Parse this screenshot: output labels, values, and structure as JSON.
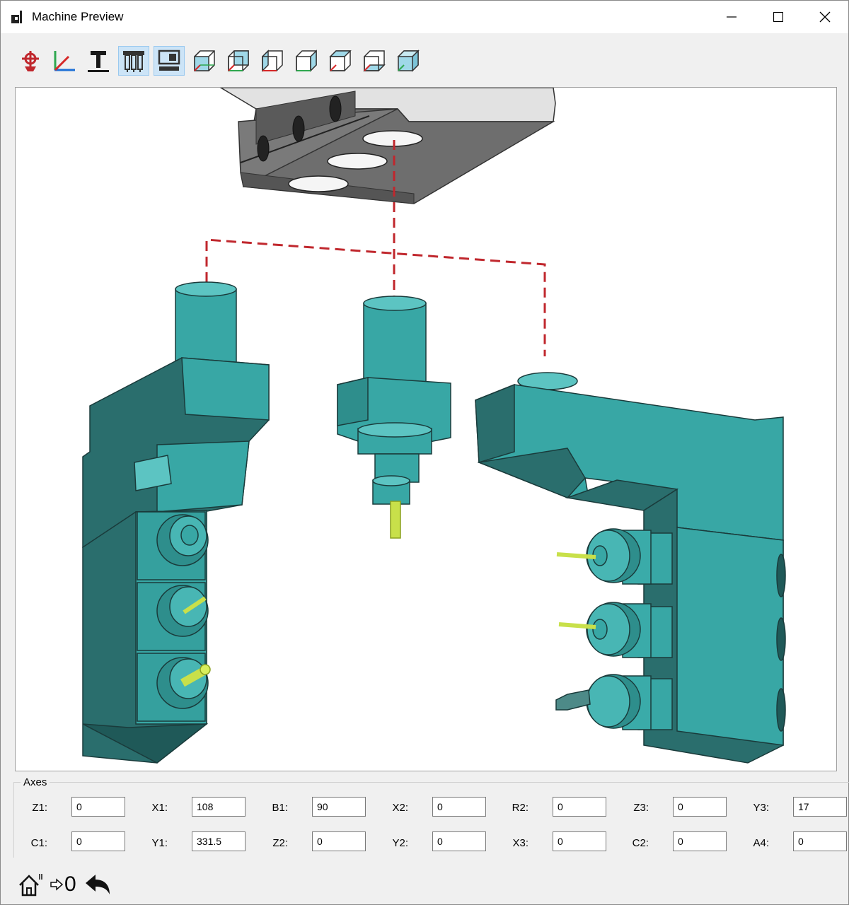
{
  "window": {
    "title": "Machine Preview"
  },
  "toolbar": {
    "buttons": [
      {
        "icon": "machine-icon",
        "active": false
      },
      {
        "icon": "axes-icon",
        "active": false
      },
      {
        "icon": "text-icon",
        "active": false
      },
      {
        "icon": "tools-icon",
        "active": true
      },
      {
        "icon": "workpiece-icon",
        "active": true
      },
      {
        "icon": "view-cube-front-icon",
        "active": false
      },
      {
        "icon": "view-cube-back-icon",
        "active": false
      },
      {
        "icon": "view-cube-left-icon",
        "active": false
      },
      {
        "icon": "view-cube-right-icon",
        "active": false
      },
      {
        "icon": "view-cube-top-icon",
        "active": false
      },
      {
        "icon": "view-cube-bottom-icon",
        "active": false
      },
      {
        "icon": "view-cube-iso-icon",
        "active": false
      }
    ]
  },
  "colors": {
    "accent_teal": "#38a7a5",
    "tool_yellow": "#c8e04a",
    "link_red": "#c0272d"
  },
  "axes": {
    "legend": "Axes",
    "row1": [
      {
        "label": "Z1:",
        "value": "0"
      },
      {
        "label": "X1:",
        "value": "108"
      },
      {
        "label": "B1:",
        "value": "90"
      },
      {
        "label": "X2:",
        "value": "0"
      },
      {
        "label": "R2:",
        "value": "0"
      },
      {
        "label": "Z3:",
        "value": "0"
      },
      {
        "label": "Y3:",
        "value": "17"
      }
    ],
    "row2": [
      {
        "label": "C1:",
        "value": "0"
      },
      {
        "label": "Y1:",
        "value": "331.5"
      },
      {
        "label": "Z2:",
        "value": "0"
      },
      {
        "label": "Y2:",
        "value": "0"
      },
      {
        "label": "X3:",
        "value": "0"
      },
      {
        "label": "C2:",
        "value": "0"
      },
      {
        "label": "A4:",
        "value": "0"
      }
    ]
  },
  "bottom": {
    "zero_label": "0"
  }
}
